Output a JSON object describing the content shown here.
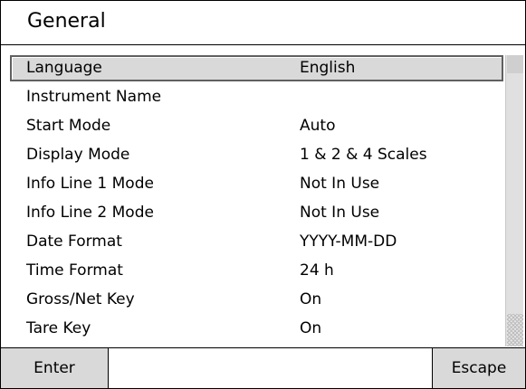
{
  "header": {
    "title": "General"
  },
  "settings": {
    "rows": [
      {
        "name": "Language",
        "value": "English",
        "selected": true
      },
      {
        "name": "Instrument Name",
        "value": ""
      },
      {
        "name": "Start Mode",
        "value": "Auto"
      },
      {
        "name": "Display Mode",
        "value": "1 & 2 & 4 Scales"
      },
      {
        "name": "Info Line 1 Mode",
        "value": "Not In Use"
      },
      {
        "name": "Info Line 2 Mode",
        "value": "Not In Use"
      },
      {
        "name": "Date Format",
        "value": "YYYY-MM-DD"
      },
      {
        "name": "Time Format",
        "value": "24 h"
      },
      {
        "name": "Gross/Net Key",
        "value": "On"
      },
      {
        "name": "Tare Key",
        "value": "On"
      }
    ]
  },
  "softkeys": {
    "left_label": "Enter",
    "right_label": "Escape"
  }
}
